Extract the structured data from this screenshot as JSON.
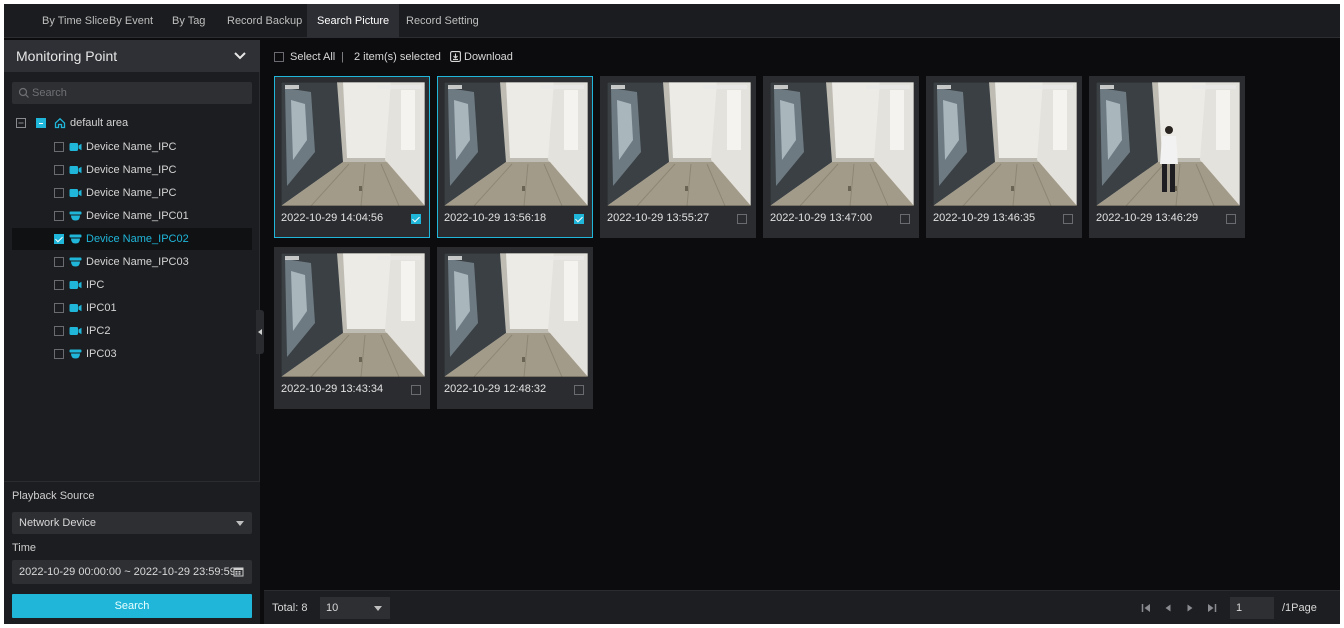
{
  "tabs": [
    {
      "label": "By Time Slice",
      "active": false
    },
    {
      "label": "By Event",
      "active": false
    },
    {
      "label": "By Tag",
      "active": false
    },
    {
      "label": "Record Backup",
      "active": false
    },
    {
      "label": "Search Picture",
      "active": true
    },
    {
      "label": "Record Setting",
      "active": false
    }
  ],
  "sidebar": {
    "title": "Monitoring Point",
    "search_placeholder": "Search",
    "area": "default area",
    "devices": [
      {
        "name": "Device Name_IPC",
        "icon": "camera-icon",
        "checked": false
      },
      {
        "name": "Device Name_IPC",
        "icon": "camera-icon",
        "checked": false
      },
      {
        "name": "Device Name_IPC",
        "icon": "camera-icon",
        "checked": false
      },
      {
        "name": "Device Name_IPC01",
        "icon": "dome-camera-icon",
        "checked": false
      },
      {
        "name": "Device Name_IPC02",
        "icon": "dome-camera-icon",
        "checked": true
      },
      {
        "name": "Device Name_IPC03",
        "icon": "dome-camera-icon",
        "checked": false
      },
      {
        "name": "IPC",
        "icon": "camera-icon",
        "checked": false
      },
      {
        "name": "IPC01",
        "icon": "camera-icon",
        "checked": false
      },
      {
        "name": "IPC2",
        "icon": "camera-icon",
        "checked": false
      },
      {
        "name": "IPC03",
        "icon": "dome-camera-icon",
        "checked": false
      }
    ],
    "playback_source_label": "Playback Source",
    "playback_source_value": "Network Device",
    "time_label": "Time",
    "time_value": "2022-10-29 00:00:00 ~ 2022-10-29 23:59:59",
    "search_button": "Search"
  },
  "toolbar": {
    "select_all": "Select All",
    "separator": "|",
    "selected_count": "2 item(s) selected",
    "download": "Download"
  },
  "pictures": [
    {
      "timestamp": "2022-10-29 14:04:56",
      "checked": true,
      "person": false
    },
    {
      "timestamp": "2022-10-29 13:56:18",
      "checked": true,
      "person": false
    },
    {
      "timestamp": "2022-10-29 13:55:27",
      "checked": false,
      "person": false
    },
    {
      "timestamp": "2022-10-29 13:47:00",
      "checked": false,
      "person": false
    },
    {
      "timestamp": "2022-10-29 13:46:35",
      "checked": false,
      "person": false
    },
    {
      "timestamp": "2022-10-29 13:46:29",
      "checked": false,
      "person": true
    },
    {
      "timestamp": "2022-10-29 13:43:34",
      "checked": false,
      "person": false
    },
    {
      "timestamp": "2022-10-29 12:48:32",
      "checked": false,
      "person": false
    }
  ],
  "pager": {
    "total": "Total: 8",
    "page_size": "10",
    "current_page": "1",
    "page_total": "/1Page"
  },
  "colors": {
    "accent": "#1fb6d9",
    "background": "#0c0c0e",
    "panel": "#1c1d20"
  }
}
